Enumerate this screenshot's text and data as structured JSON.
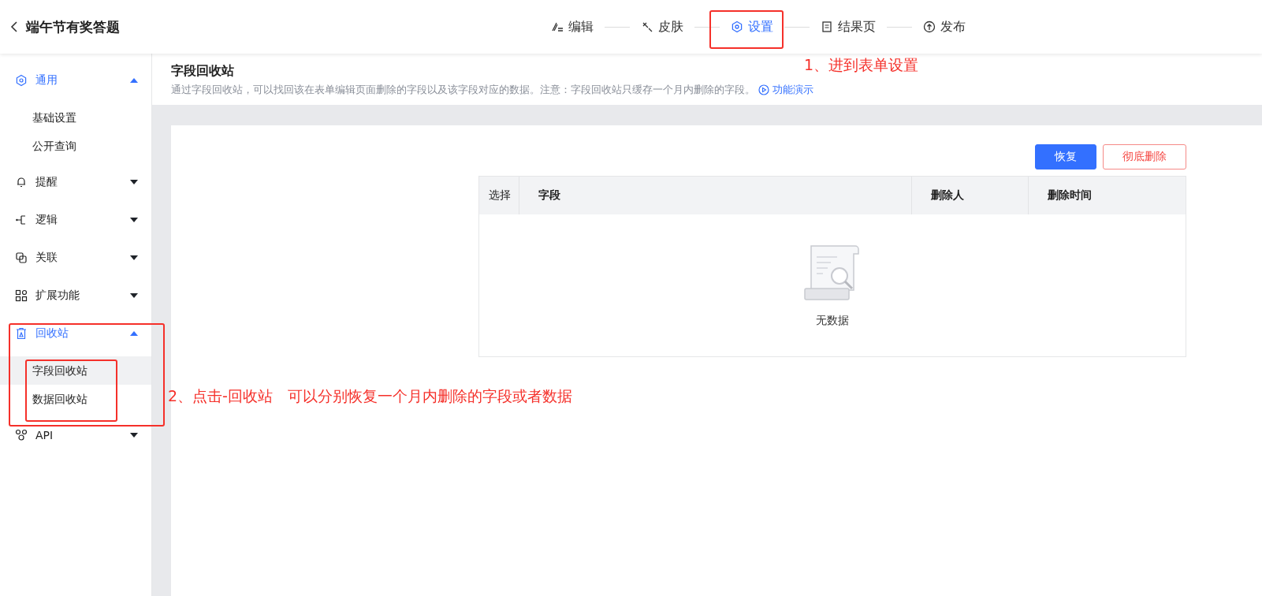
{
  "header": {
    "title": "端午节有奖答题"
  },
  "steps": [
    {
      "label": "编辑",
      "selected": false
    },
    {
      "label": "皮肤",
      "selected": false
    },
    {
      "label": "设置",
      "selected": true
    },
    {
      "label": "结果页",
      "selected": false
    },
    {
      "label": "发布",
      "selected": false
    }
  ],
  "sidebar": {
    "items": [
      {
        "label": "通用",
        "expanded": true,
        "children": [
          {
            "label": "基础设置",
            "selected": false
          },
          {
            "label": "公开查询",
            "selected": false
          }
        ]
      },
      {
        "label": "提醒",
        "expanded": false
      },
      {
        "label": "逻辑",
        "expanded": false
      },
      {
        "label": "关联",
        "expanded": false
      },
      {
        "label": "扩展功能",
        "expanded": false
      },
      {
        "label": "回收站",
        "expanded": true,
        "children": [
          {
            "label": "字段回收站",
            "selected": true
          },
          {
            "label": "数据回收站",
            "selected": false
          }
        ]
      },
      {
        "label": "API",
        "expanded": false
      }
    ]
  },
  "page": {
    "title": "字段回收站",
    "description": "通过字段回收站，可以找回该在表单编辑页面删除的字段以及该字段对应的数据。注意：字段回收站只缓存一个月内删除的字段。",
    "demo_link": "功能演示"
  },
  "buttons": [
    {
      "label": "恢复",
      "kind": "primary"
    },
    {
      "label": "彻底删除",
      "kind": "danger"
    }
  ],
  "table": {
    "columns": [
      "选择",
      "字段",
      "删除人",
      "删除时间"
    ],
    "empty_text": "无数据"
  },
  "annotations": [
    "1、进到表单设置",
    "2、点击-回收站　可以分别恢复一个月内删除的字段或者数据"
  ]
}
